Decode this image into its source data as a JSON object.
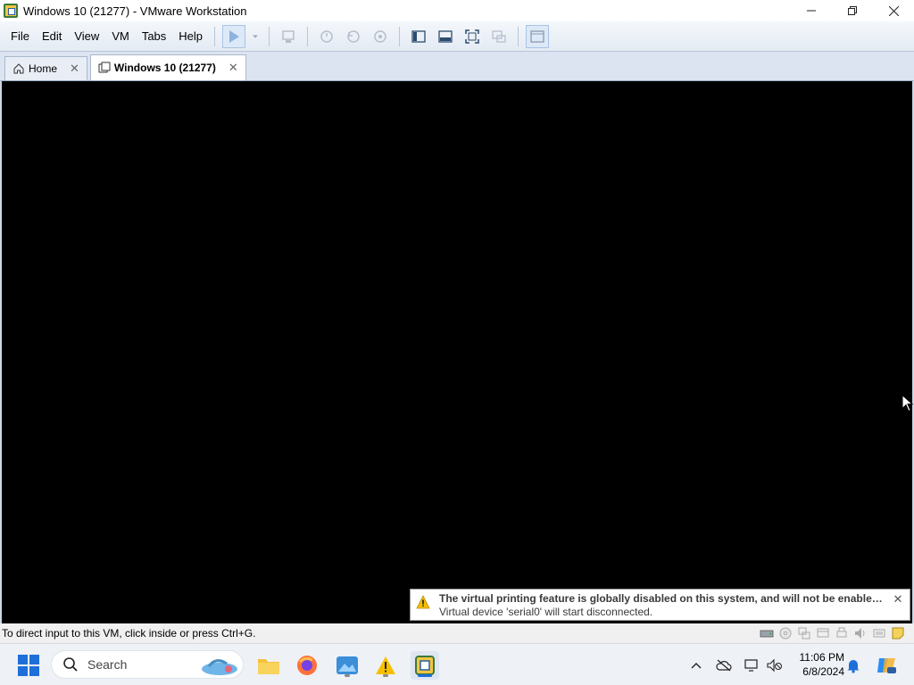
{
  "window": {
    "title": "Windows 10 (21277) - VMware Workstation",
    "controls": [
      "minimize",
      "maximize",
      "close"
    ]
  },
  "menu": {
    "items": [
      "File",
      "Edit",
      "View",
      "VM",
      "Tabs",
      "Help"
    ]
  },
  "toolbar": {
    "icons": [
      "play-icon",
      "dropdown-icon",
      "send-ctrl-alt-del-icon",
      "snapshot-icon",
      "revert-snapshot-icon",
      "snapshot-manager-icon",
      "library-icon",
      "thumbnail-bar-icon",
      "full-screen-icon",
      "unity-icon",
      "console-view-icon"
    ]
  },
  "tabs": [
    {
      "label": "Home",
      "active": false
    },
    {
      "label": "Windows 10 (21277)",
      "active": true
    }
  ],
  "notification": {
    "title": "The virtual printing feature is globally disabled on this system, and will not be enabled for t...",
    "subtitle": "Virtual device 'serial0' will start disconnected."
  },
  "statusbar": {
    "text": "To direct input to this VM, click inside or press Ctrl+G."
  },
  "taskbar": {
    "search_placeholder": "Search",
    "apps": [
      "file-explorer",
      "firefox",
      "photos",
      "warning-app",
      "vmware-workstation"
    ],
    "time": "11:06 PM",
    "date": "6/8/2024"
  },
  "colors": {
    "vm_background": "#000000",
    "accent": "#1e6fd9",
    "toolbar_bg": "#e4ebf4"
  }
}
